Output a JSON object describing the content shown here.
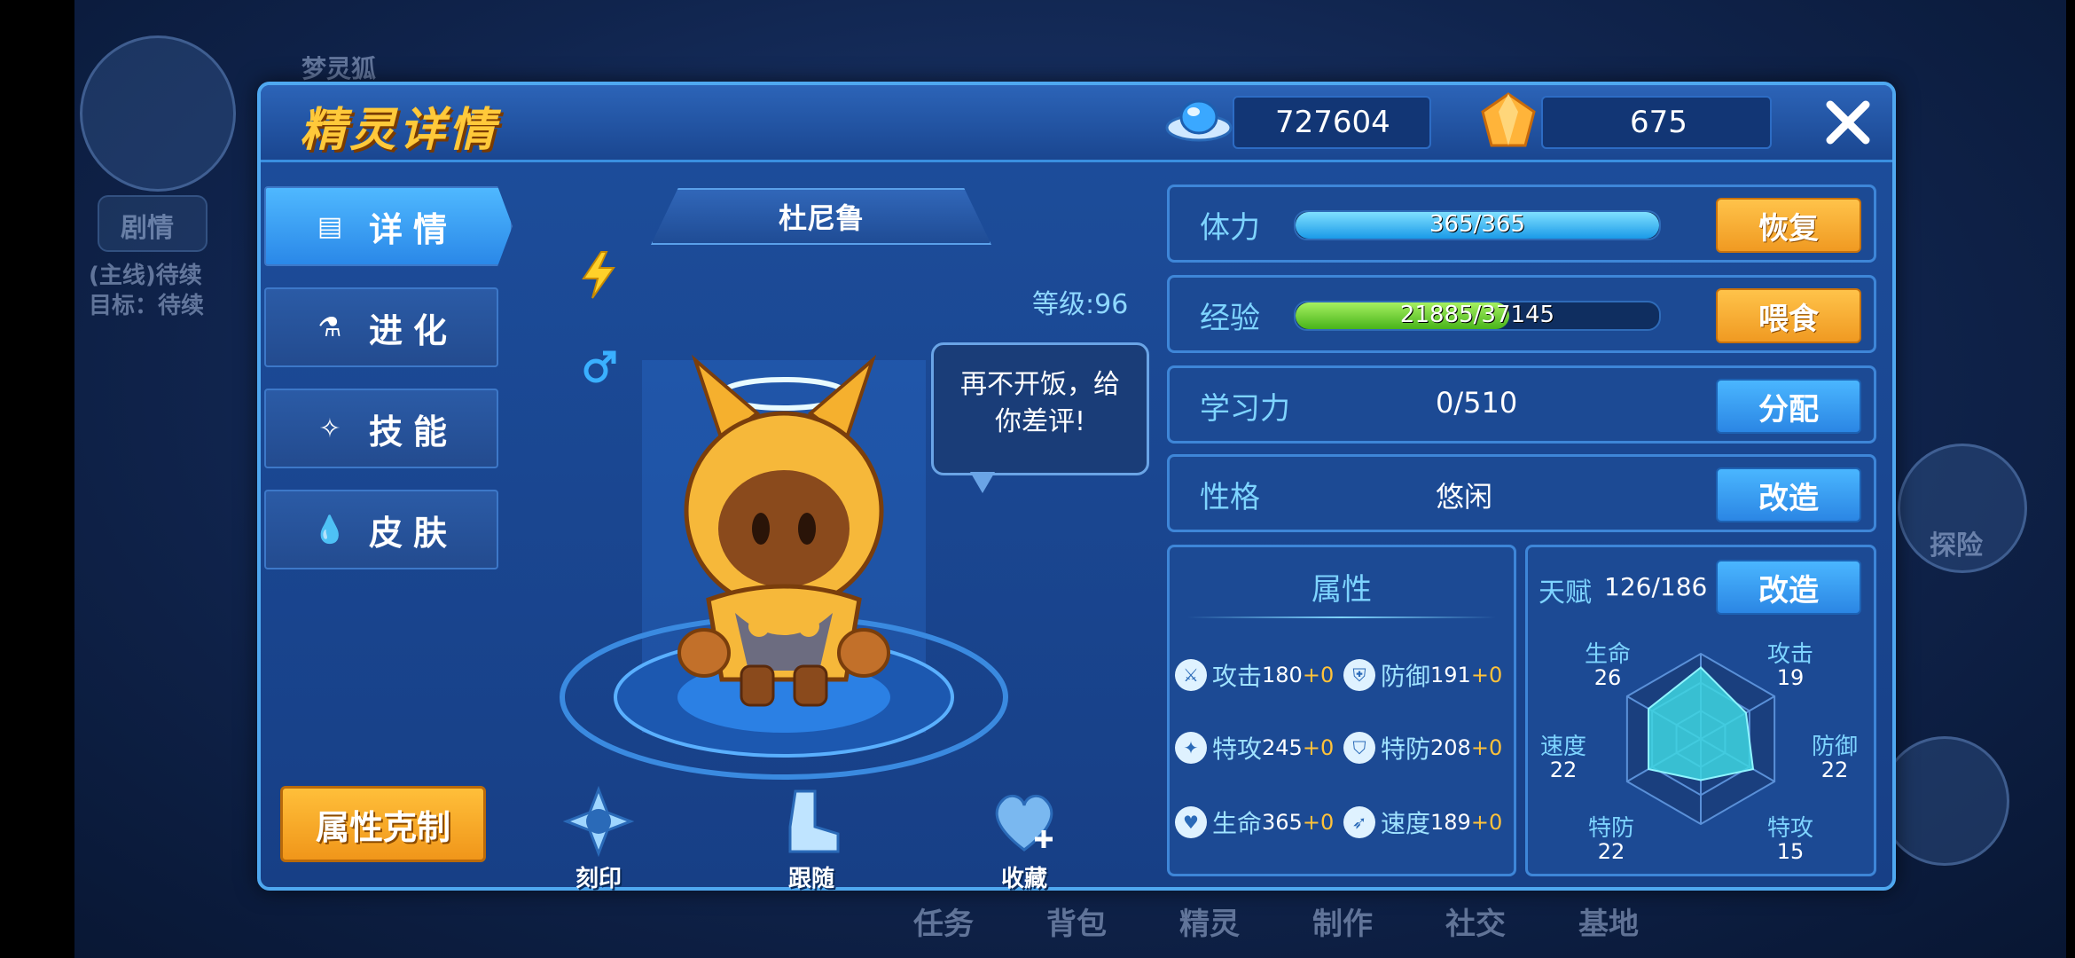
{
  "window": {
    "title": "精灵详情"
  },
  "currency": {
    "coins": "727604",
    "diamonds": "675"
  },
  "tabs": [
    {
      "label": "详情",
      "icon": "details-icon",
      "active": true
    },
    {
      "label": "进化",
      "icon": "flask-icon",
      "active": false
    },
    {
      "label": "技能",
      "icon": "sparkle-icon",
      "active": false
    },
    {
      "label": "皮肤",
      "icon": "droplet-icon",
      "active": false
    }
  ],
  "counter_button": "属性克制",
  "pet": {
    "name": "杜尼鲁",
    "level": "等级:96",
    "speech": [
      "再不开饭，给",
      "你差评!"
    ],
    "element_icon": "lightning-icon",
    "gender_icon": "male-icon"
  },
  "bottom_actions": [
    {
      "label": "刻印",
      "icon": "imprint-icon"
    },
    {
      "label": "跟随",
      "icon": "boot-icon"
    },
    {
      "label": "收藏",
      "icon": "heart-plus-icon"
    }
  ],
  "stats": {
    "stamina": {
      "label": "体力",
      "value": "365/365",
      "fraction": 1.0,
      "button": "恢复",
      "color": "#3fc3ff"
    },
    "exp": {
      "label": "经验",
      "value": "21885/37145",
      "fraction": 0.589,
      "button": "喂食",
      "color": "#6fd23a"
    },
    "learning": {
      "label": "学习力",
      "value": "0/510",
      "button": "分配"
    },
    "nature": {
      "label": "性格",
      "value": "悠闲",
      "button": "改造"
    }
  },
  "attributes": {
    "title": "属性",
    "items": [
      {
        "name": "攻击",
        "value": "180",
        "bonus": "+0",
        "icon": "attack-icon"
      },
      {
        "name": "防御",
        "value": "191",
        "bonus": "+0",
        "icon": "defense-icon"
      },
      {
        "name": "特攻",
        "value": "245",
        "bonus": "+0",
        "icon": "sp-attack-icon"
      },
      {
        "name": "特防",
        "value": "208",
        "bonus": "+0",
        "icon": "sp-defense-icon"
      },
      {
        "name": "生命",
        "value": "365",
        "bonus": "+0",
        "icon": "hp-icon"
      },
      {
        "name": "速度",
        "value": "189",
        "bonus": "+0",
        "icon": "speed-icon"
      }
    ]
  },
  "talent": {
    "label": "天赋",
    "value": "126/186",
    "button": "改造",
    "radar": [
      {
        "name": "生命",
        "value": "26"
      },
      {
        "name": "攻击",
        "value": "19"
      },
      {
        "name": "防御",
        "value": "22"
      },
      {
        "name": "特攻",
        "value": "15"
      },
      {
        "name": "特防",
        "value": "22"
      },
      {
        "name": "速度",
        "value": "22"
      }
    ],
    "radar_max": 31
  },
  "background": {
    "labels": [
      "梦灵狐",
      "剧情",
      "(主线)待续",
      "目标：待续",
      "探险",
      "任务",
      "背包",
      "精灵",
      "制作",
      "社交",
      "基地"
    ]
  }
}
